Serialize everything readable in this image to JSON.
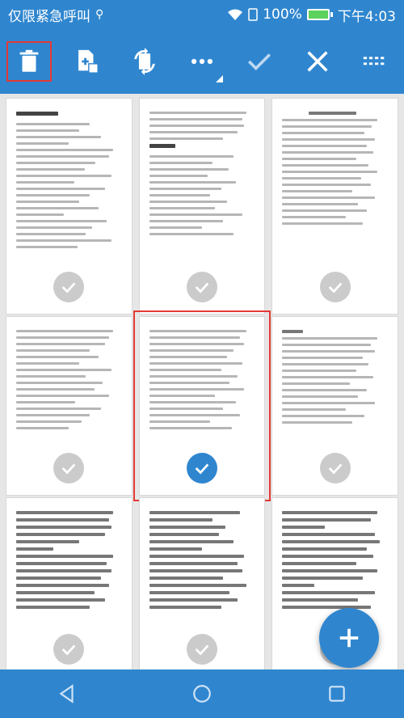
{
  "status_bar": {
    "carrier": "仅限紧急呼叫",
    "usb_icon": "usb-icon",
    "wifi_icon": "wifi-icon",
    "battery_percent": "100%",
    "time": "下午4:03",
    "colors": {
      "bar": "#2f86cf"
    }
  },
  "toolbar": {
    "items": [
      {
        "name": "delete-button",
        "icon": "trash-icon",
        "selected": true
      },
      {
        "name": "add-page-button",
        "icon": "add-page-icon"
      },
      {
        "name": "rotate-button",
        "icon": "rotate-icon"
      },
      {
        "name": "more-button",
        "icon": "more-dots-icon"
      },
      {
        "name": "confirm-button",
        "icon": "check-icon"
      },
      {
        "name": "close-button",
        "icon": "close-icon"
      },
      {
        "name": "grid-view-button",
        "icon": "grid-dots-icon"
      }
    ]
  },
  "pages": [
    {
      "id": 1,
      "selected": false
    },
    {
      "id": 2,
      "selected": false
    },
    {
      "id": 3,
      "selected": false
    },
    {
      "id": 4,
      "selected": false
    },
    {
      "id": 5,
      "selected": true
    },
    {
      "id": 6,
      "selected": false
    },
    {
      "id": 7,
      "selected": false
    },
    {
      "id": 8,
      "selected": false
    },
    {
      "id": 9,
      "selected": false
    }
  ],
  "fab": {
    "icon": "plus-icon"
  },
  "nav": {
    "back": "back-icon",
    "home": "home-icon",
    "recent": "recent-apps-icon"
  },
  "colors": {
    "accent": "#2f86cf",
    "highlight": "#e53935"
  }
}
